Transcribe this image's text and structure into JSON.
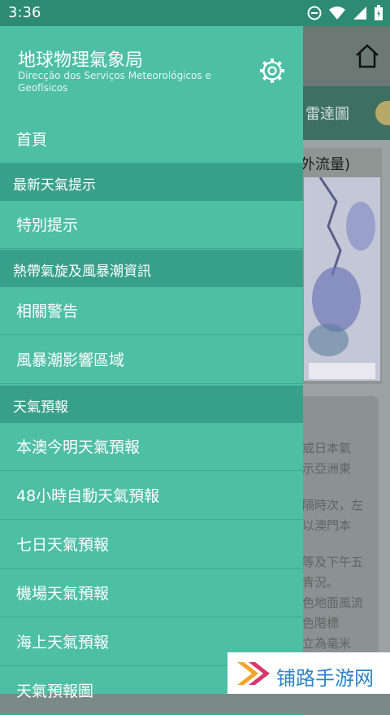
{
  "status": {
    "time": "3:36"
  },
  "colors": {
    "drawer": "#4dbfa4",
    "section": "#38a08a",
    "statusbar": "#2d8a73"
  },
  "background": {
    "tab_radar": "雷達圖",
    "card_title": "外流量)",
    "text_lines": [
      "或日本氣",
      "示亞洲東",
      "隔時次，左",
      "以澳門本",
      "等及下午五",
      "青況。",
      "色地面風流",
      "色階標",
      "立為毫米"
    ]
  },
  "drawer": {
    "title": "地球物理氣象局",
    "subtitle": "Direcção dos Serviços Meteorológicos e Geofísicos",
    "items": [
      {
        "type": "item",
        "label": "首頁"
      },
      {
        "type": "section",
        "label": "最新天氣提示"
      },
      {
        "type": "item",
        "label": "特別提示"
      },
      {
        "type": "section",
        "label": "熱帶氣旋及風暴潮資訊"
      },
      {
        "type": "item",
        "label": "相關警告"
      },
      {
        "type": "item",
        "label": "風暴潮影響區域"
      },
      {
        "type": "section",
        "label": "天氣預報"
      },
      {
        "type": "item",
        "label": "本澳今明天氣預報"
      },
      {
        "type": "item",
        "label": "48小時自動天氣預報"
      },
      {
        "type": "item",
        "label": "七日天氣預報"
      },
      {
        "type": "item",
        "label": "機場天氣預報"
      },
      {
        "type": "item",
        "label": "海上天氣預報"
      },
      {
        "type": "item",
        "label": "天氣預報圖"
      }
    ]
  },
  "watermark": {
    "text": "铺路手游网"
  }
}
